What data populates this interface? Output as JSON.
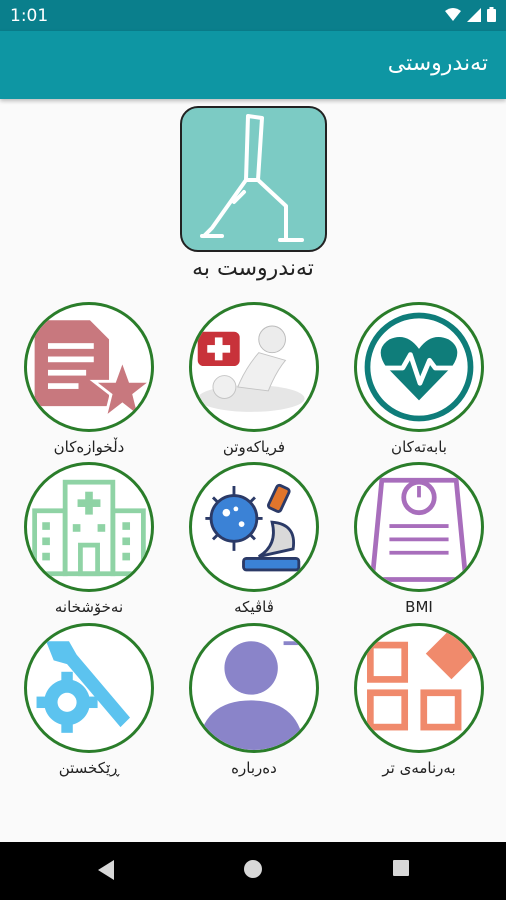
{
  "status": {
    "time": "1:01",
    "icons": [
      "wifi-icon",
      "signal-icon",
      "battery-icon"
    ]
  },
  "app_bar": {
    "title": "تەندروستی"
  },
  "hero": {
    "icon": "yoga-pose-icon",
    "label": "تەندروست بە"
  },
  "tiles": [
    {
      "label": "بابەتەکان",
      "icon": "heart-pulse-icon"
    },
    {
      "label": "فریاکەوتن",
      "icon": "first-aid-icon"
    },
    {
      "label": "دڵخوازەکان",
      "icon": "favorites-document-star-icon"
    },
    {
      "label": "BMI",
      "icon": "scale-icon"
    },
    {
      "label": "ڤاڤیکە",
      "icon": "virus-microscope-icon"
    },
    {
      "label": "نەخۆشخانە",
      "icon": "hospital-icon"
    },
    {
      "label": "بەرنامەی تر",
      "icon": "more-apps-icon"
    },
    {
      "label": "دەربارە",
      "icon": "about-user-icon"
    },
    {
      "label": "ڕێکخستن",
      "icon": "settings-wrench-gear-icon"
    }
  ],
  "nav": {
    "icons": [
      "back-icon",
      "home-icon",
      "recents-icon"
    ]
  },
  "colors": {
    "status_bar": "#0a7f8c",
    "app_bar": "#0e96a3",
    "tile_border": "#2a7d2a",
    "hero_bg": "#7ccbc4"
  }
}
